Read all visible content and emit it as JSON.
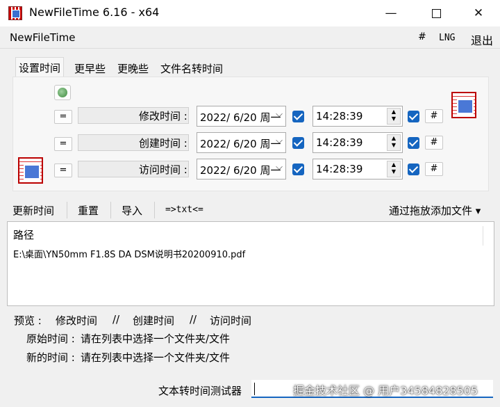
{
  "window": {
    "title": "NewFileTime 6.16 - x64",
    "minimize": "—",
    "close": "✕"
  },
  "menu": {
    "app": "NewFileTime",
    "hash": "#",
    "lng": "LNG",
    "exit": "退出"
  },
  "tabs": [
    "设置时间",
    "更早些",
    "更晚些",
    "文件名转时间"
  ],
  "time_rows": [
    {
      "eq": "=",
      "label": "修改时间 :",
      "date": "2022/  6/20 周一",
      "time": "14:28:39",
      "hash": "#"
    },
    {
      "eq": "=",
      "label": "创建时间 :",
      "date": "2022/  6/20 周一",
      "time": "14:28:39",
      "hash": "#"
    },
    {
      "eq": "=",
      "label": "访问时间 :",
      "date": "2022/  6/20 周一",
      "time": "14:28:39",
      "hash": "#"
    }
  ],
  "toolbar": {
    "update": "更新时间",
    "reset": "重置",
    "import": "导入",
    "txt": "=>txt<=",
    "drag": "通过拖放添加文件 ▾"
  },
  "list": {
    "header": "路径",
    "rows": [
      "E:\\桌面\\YN50mm F1.8S DA DSM说明书20200910.pdf"
    ]
  },
  "preview": {
    "label": "预览 :",
    "modify": "修改时间",
    "sep1": "//",
    "create": "创建时间",
    "sep2": "//",
    "access": "访问时间",
    "original_label": "原始时间 :",
    "original_value": "请在列表中选择一个文件夹/文件",
    "new_label": "新的时间 :",
    "new_value": "请在列表中选择一个文件夹/文件"
  },
  "footer": {
    "tester_label": "文本转时间测试器",
    "watermark": "掘金技术社区 @ 用户34584828505"
  },
  "colors": {
    "accent": "#1565c0",
    "background": "#f0f0f0"
  }
}
